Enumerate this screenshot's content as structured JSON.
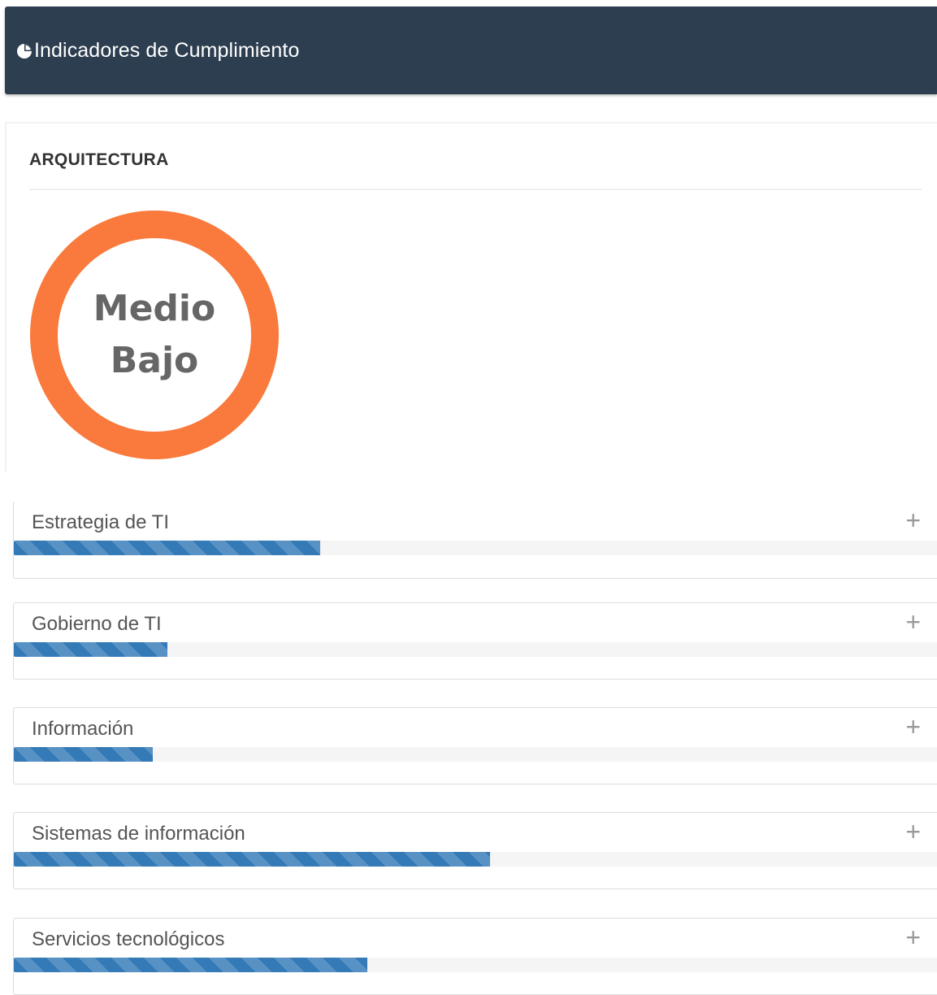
{
  "header": {
    "title": "Indicadores de Cumplimiento",
    "icon": "pie-chart-icon"
  },
  "panel": {
    "title": "ARQUITECTURA",
    "gauge": {
      "line1": "Medio",
      "line2": "Bajo",
      "color": "#f97a3c"
    }
  },
  "items": [
    {
      "label": "Estrategia de TI",
      "progress_percent": 33.2,
      "expand_icon": "plus-icon"
    },
    {
      "label": "Gobierno de TI",
      "progress_percent": 16.6,
      "expand_icon": "plus-icon"
    },
    {
      "label": "Información",
      "progress_percent": 15.0,
      "expand_icon": "plus-icon"
    },
    {
      "label": "Sistemas de información",
      "progress_percent": 51.5,
      "expand_icon": "plus-icon"
    },
    {
      "label": "Servicios tecnológicos",
      "progress_percent": 38.3,
      "expand_icon": "plus-icon"
    }
  ],
  "colors": {
    "header_bg": "#2d3e50",
    "bar_fill": "#337ab7",
    "bar_track": "#f5f5f5"
  }
}
